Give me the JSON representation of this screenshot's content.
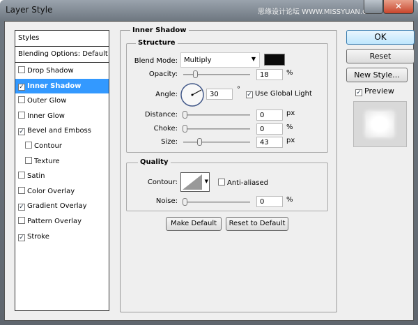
{
  "window": {
    "title": "Layer Style",
    "watermark": "思缘设计论坛 WWW.MISSYUAN.COM"
  },
  "styles_list": {
    "header": "Styles",
    "blending": "Blending Options: Default",
    "items": [
      {
        "label": "Drop Shadow",
        "checked": false
      },
      {
        "label": "Inner Shadow",
        "checked": true,
        "selected": true
      },
      {
        "label": "Outer Glow",
        "checked": false
      },
      {
        "label": "Inner Glow",
        "checked": false
      },
      {
        "label": "Bevel and Emboss",
        "checked": true
      },
      {
        "label": "Contour",
        "checked": false,
        "indent": true
      },
      {
        "label": "Texture",
        "checked": false,
        "indent": true
      },
      {
        "label": "Satin",
        "checked": false
      },
      {
        "label": "Color Overlay",
        "checked": false
      },
      {
        "label": "Gradient Overlay",
        "checked": true
      },
      {
        "label": "Pattern Overlay",
        "checked": false
      },
      {
        "label": "Stroke",
        "checked": true
      }
    ]
  },
  "panel": {
    "title": "Inner Shadow",
    "structure": {
      "title": "Structure",
      "blend_mode_label": "Blend Mode:",
      "blend_mode": "Multiply",
      "color": "#0a0a0a",
      "opacity_label": "Opacity:",
      "opacity": "18",
      "opacity_unit": "%",
      "angle_label": "Angle:",
      "angle": "30",
      "angle_unit": "°",
      "global_light_label": "Use Global Light",
      "global_light": true,
      "distance_label": "Distance:",
      "distance": "0",
      "distance_unit": "px",
      "choke_label": "Choke:",
      "choke": "0",
      "choke_unit": "%",
      "size_label": "Size:",
      "size": "43",
      "size_unit": "px"
    },
    "quality": {
      "title": "Quality",
      "contour_label": "Contour:",
      "anti_aliased_label": "Anti-aliased",
      "noise_label": "Noise:",
      "noise": "0",
      "noise_unit": "%"
    },
    "make_default": "Make Default",
    "reset_default": "Reset to Default"
  },
  "buttons": {
    "ok": "OK",
    "reset": "Reset",
    "new_style": "New Style...",
    "preview_label": "Preview"
  },
  "colors": {
    "selection": "#3399ff"
  }
}
